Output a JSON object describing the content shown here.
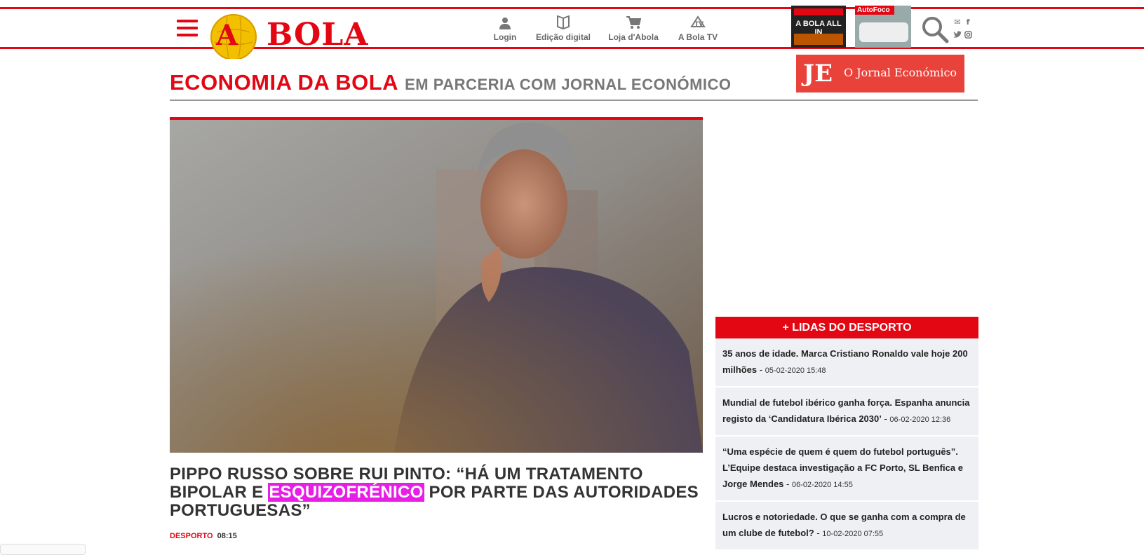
{
  "header": {
    "logo_text": "A BOLA",
    "nav": [
      {
        "label": "Login",
        "icon": "user-icon"
      },
      {
        "label": "Edição digital",
        "icon": "book-icon"
      },
      {
        "label": "Loja d'Abola",
        "icon": "cart-icon"
      },
      {
        "label": "A Bola TV",
        "icon": "tv-icon"
      }
    ],
    "covers": [
      {
        "label": "A BOLA ALL IN"
      },
      {
        "label": "AutoFoco"
      }
    ],
    "social": [
      "email-icon",
      "facebook-icon",
      "twitter-icon",
      "instagram-icon"
    ]
  },
  "section": {
    "title": "ECONOMIA DA BOLA",
    "subtitle": "EM PARCERIA COM JORNAL ECONÓMICO",
    "partner_mark": "JE",
    "partner_name": "O Jornal Económico"
  },
  "article": {
    "headline_before": "PIPPO RUSSO SOBRE RUI PINTO: “HÁ UM TRATAMENTO BIPOLAR E ",
    "headline_highlight": "ESQUIZOFRÉNICO",
    "headline_after": " POR PARTE DAS AUTORIDADES PORTUGUESAS”",
    "category": "DESPORTO",
    "time": "08:15"
  },
  "most_read": {
    "title": "+ LIDAS DO DESPORTO",
    "items": [
      {
        "title": "35 anos de idade. Marca Cristiano Ronaldo vale hoje 200 milhões",
        "date": "05-02-2020 15:48"
      },
      {
        "title": "Mundial de futebol ibérico ganha força. Espanha anuncia registo da ‘Candidatura Ibérica 2030’",
        "date": "06-02-2020 12:36"
      },
      {
        "title": "“Uma espécie de quem é quem do futebol português”. L’Equipe destaca investigação a FC Porto, SL Benfica e Jorge Mendes",
        "date": "06-02-2020 14:55"
      },
      {
        "title": "Lucros e notoriedade. O que se ganha com a compra de um clube de futebol?",
        "date": "10-02-2020 07:55"
      }
    ]
  },
  "colors": {
    "brand_red": "#e30613",
    "highlight": "#e61ee6",
    "partner": "#e8423a"
  }
}
